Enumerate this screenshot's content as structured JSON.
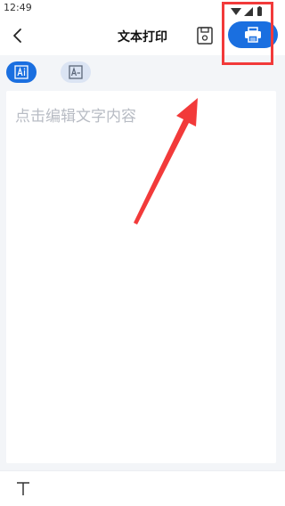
{
  "status_bar": {
    "time": "12:49"
  },
  "header": {
    "title": "文本打印",
    "back_icon": "chevron-left-icon",
    "save_icon": "save-icon",
    "print_icon": "printer-icon",
    "accent_color": "#1a6fe0"
  },
  "toolbar": {
    "mode_ai_icon": "ai-text-icon",
    "mode_layout_icon": "text-layout-icon",
    "active_mode": "ai-text"
  },
  "editor": {
    "placeholder": "点击编辑文字内容"
  },
  "bottom_bar": {
    "text_style_icon": "text-style-icon"
  },
  "annotation": {
    "highlight_color": "#f23a3a"
  }
}
